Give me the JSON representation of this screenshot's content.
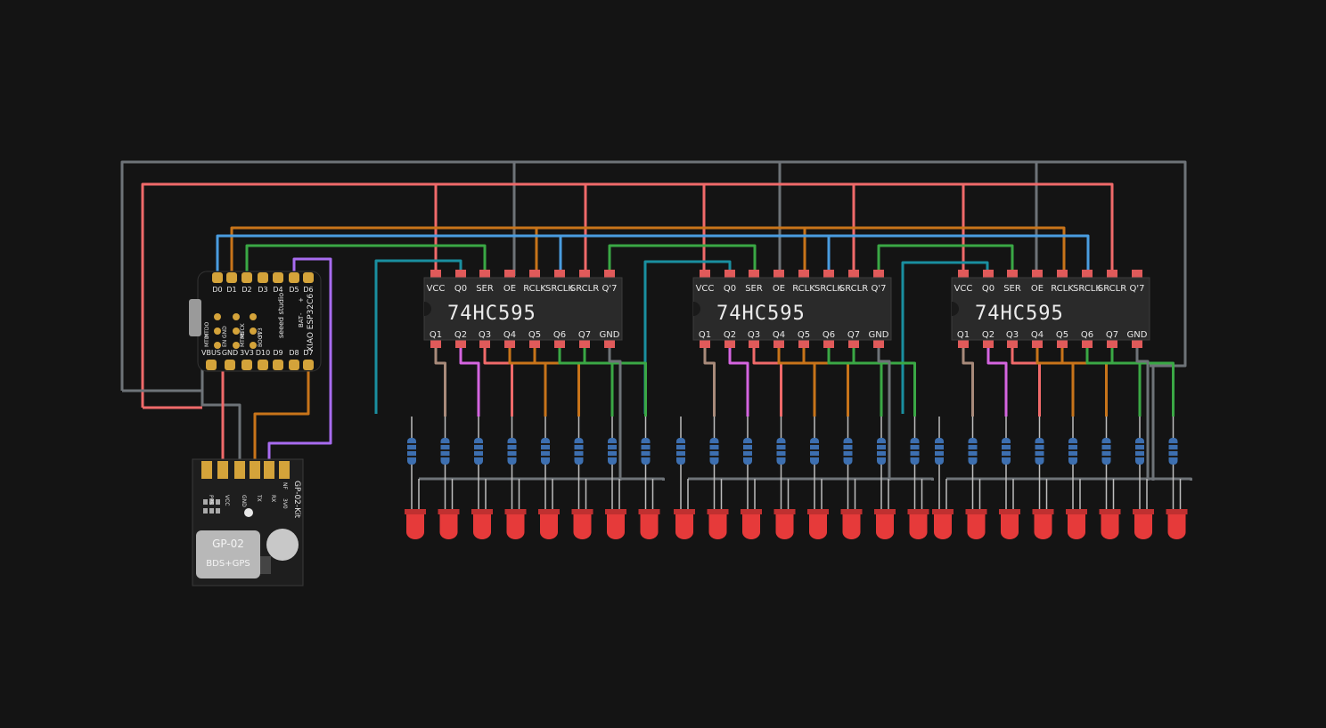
{
  "colors": {
    "background": "#141414",
    "wire_red": "#f06a6a",
    "wire_gray": "#6e7378",
    "wire_orange": "#c8741a",
    "wire_blue": "#4a9de0",
    "wire_green": "#3aa845",
    "wire_teal": "#1a8fa0",
    "wire_brown": "#a88a7a",
    "wire_magenta": "#d565e0",
    "wire_purple": "#a86cf0",
    "led_red": "#e63a3a",
    "resistor_blue": "#3d6fb0",
    "chip_body": "#2a2a2a",
    "pin_red": "#e05a5a"
  },
  "mcu": {
    "name": "XIAO ESP32C6",
    "brand": "seeed studio",
    "top_pins": [
      "D0",
      "D1",
      "D2",
      "D3",
      "D4",
      "D5",
      "D6"
    ],
    "bottom_pins": [
      "VBUS",
      "GND",
      "3V3",
      "D10",
      "D9",
      "D8",
      "D7"
    ],
    "silk_inner": [
      "MTDO",
      "MTDI",
      "GND",
      "EN",
      "MTCK",
      "MTMS",
      "3V3",
      "BOOT"
    ],
    "bat_labels": [
      "BAT",
      "-",
      "+"
    ]
  },
  "gps": {
    "name": "GP-02-Kit",
    "module": "GP-02",
    "module_sub": "BDS+GPS",
    "pins": [
      "PPS",
      "VCC",
      "GND",
      "TX",
      "RX"
    ],
    "side_labels": [
      "NF",
      "3V0"
    ]
  },
  "shift_registers": [
    {
      "chip_label": "74HC595",
      "top_pins": [
        "VCC",
        "Q0",
        "SER",
        "OE",
        "RCLK",
        "SRCLK",
        "SRCLR",
        "Q'7"
      ],
      "bottom_pins": [
        "Q1",
        "Q2",
        "Q3",
        "Q4",
        "Q5",
        "Q6",
        "Q7",
        "GND"
      ]
    },
    {
      "chip_label": "74HC595",
      "top_pins": [
        "VCC",
        "Q0",
        "SER",
        "OE",
        "RCLK",
        "SRCLK",
        "SRCLR",
        "Q'7"
      ],
      "bottom_pins": [
        "Q1",
        "Q2",
        "Q3",
        "Q4",
        "Q5",
        "Q6",
        "Q7",
        "GND"
      ]
    },
    {
      "chip_label": "74HC595",
      "top_pins": [
        "VCC",
        "Q0",
        "SER",
        "OE",
        "RCLK",
        "SRCLK",
        "SRCLR",
        "Q'7"
      ],
      "bottom_pins": [
        "Q1",
        "Q2",
        "Q3",
        "Q4",
        "Q5",
        "Q6",
        "Q7",
        "GND"
      ]
    }
  ],
  "led_count_per_register": 8
}
